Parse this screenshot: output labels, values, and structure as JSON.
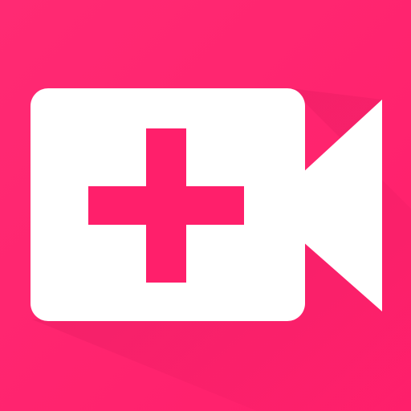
{
  "icon": {
    "name": "add-video-icon",
    "background_color": "#FF1F6B",
    "background_color_light": "#FF2A73",
    "shadow_color": "#D8195A",
    "glyph_color": "#FFFFFF"
  }
}
